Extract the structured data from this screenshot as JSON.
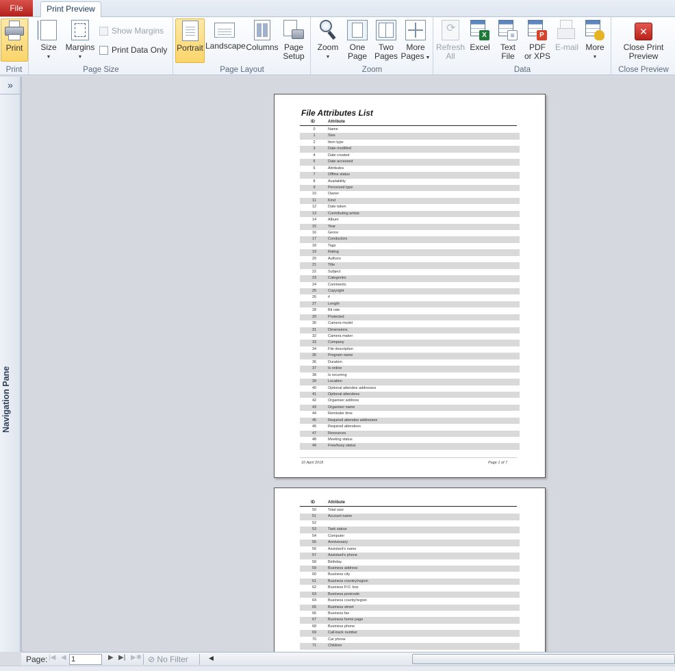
{
  "tabs": {
    "file": "File",
    "print_preview": "Print Preview"
  },
  "ribbon": {
    "print_group": {
      "label": "Print",
      "print_button": "Print"
    },
    "page_size_group": {
      "label": "Page Size",
      "size": "Size",
      "margins": "Margins",
      "show_margins": "Show Margins",
      "print_data_only": "Print Data Only"
    },
    "page_layout_group": {
      "label": "Page Layout",
      "portrait": "Portrait",
      "landscape": "Landscape",
      "columns": "Columns",
      "page_setup_1": "Page",
      "page_setup_2": "Setup"
    },
    "zoom_group": {
      "label": "Zoom",
      "zoom": "Zoom",
      "one_page_1": "One",
      "one_page_2": "Page",
      "two_pages_1": "Two",
      "two_pages_2": "Pages",
      "more_pages_1": "More",
      "more_pages_2": "Pages"
    },
    "data_group": {
      "label": "Data",
      "refresh_1": "Refresh",
      "refresh_2": "All",
      "excel": "Excel",
      "text_file_1": "Text",
      "text_file_2": "File",
      "pdf_1": "PDF",
      "pdf_2": "or XPS",
      "email": "E-mail",
      "more": "More"
    },
    "close_group": {
      "label": "Close Preview",
      "close_1": "Close Print",
      "close_2": "Preview"
    }
  },
  "nav_pane": {
    "label": "Navigation Pane",
    "expand": "»"
  },
  "report": {
    "title": "File Attributes List",
    "col_id": "ID",
    "col_attribute": "Attribute",
    "footer_date": "10 April 2018",
    "footer_page": "Page 1 of 7",
    "page1_rows": [
      [
        "0",
        "Name"
      ],
      [
        "1",
        "Size"
      ],
      [
        "2",
        "Item type"
      ],
      [
        "3",
        "Date modified"
      ],
      [
        "4",
        "Date created"
      ],
      [
        "5",
        "Date accessed"
      ],
      [
        "6",
        "Attributes"
      ],
      [
        "7",
        "Offline status"
      ],
      [
        "8",
        "Availability"
      ],
      [
        "9",
        "Perceived type"
      ],
      [
        "10",
        "Owner"
      ],
      [
        "11",
        "Kind"
      ],
      [
        "12",
        "Date taken"
      ],
      [
        "13",
        "Contributing artists"
      ],
      [
        "14",
        "Album"
      ],
      [
        "15",
        "Year"
      ],
      [
        "16",
        "Genre"
      ],
      [
        "17",
        "Conductors"
      ],
      [
        "18",
        "Tags"
      ],
      [
        "19",
        "Rating"
      ],
      [
        "20",
        "Authors"
      ],
      [
        "21",
        "Title"
      ],
      [
        "22",
        "Subject"
      ],
      [
        "23",
        "Categories"
      ],
      [
        "24",
        "Comments"
      ],
      [
        "25",
        "Copyright"
      ],
      [
        "26",
        "#"
      ],
      [
        "27",
        "Length"
      ],
      [
        "28",
        "Bit rate"
      ],
      [
        "29",
        "Protected"
      ],
      [
        "30",
        "Camera model"
      ],
      [
        "31",
        "Dimensions"
      ],
      [
        "32",
        "Camera maker"
      ],
      [
        "33",
        "Company"
      ],
      [
        "34",
        "File description"
      ],
      [
        "35",
        "Program name"
      ],
      [
        "36",
        "Duration"
      ],
      [
        "37",
        "Is online"
      ],
      [
        "38",
        "Is recurring"
      ],
      [
        "39",
        "Location"
      ],
      [
        "40",
        "Optional attendee addresses"
      ],
      [
        "41",
        "Optional attendees"
      ],
      [
        "42",
        "Organiser address"
      ],
      [
        "43",
        "Organiser name"
      ],
      [
        "44",
        "Reminder time"
      ],
      [
        "45",
        "Required attendee addresses"
      ],
      [
        "46",
        "Required attendees"
      ],
      [
        "47",
        "Resources"
      ],
      [
        "48",
        "Meeting status"
      ],
      [
        "49",
        "Free/busy status"
      ]
    ],
    "page2_rows": [
      [
        "50",
        "Total size"
      ],
      [
        "51",
        "Account name"
      ],
      [
        "52",
        ""
      ],
      [
        "53",
        "Task status"
      ],
      [
        "54",
        "Computer"
      ],
      [
        "55",
        "Anniversary"
      ],
      [
        "56",
        "Assistant's name"
      ],
      [
        "57",
        "Assistant's phone"
      ],
      [
        "58",
        "Birthday"
      ],
      [
        "59",
        "Business address"
      ],
      [
        "60",
        "Business city"
      ],
      [
        "61",
        "Business country/region"
      ],
      [
        "62",
        "Business P.O. box"
      ],
      [
        "63",
        "Business postcode"
      ],
      [
        "64",
        "Business county/region"
      ],
      [
        "65",
        "Business street"
      ],
      [
        "66",
        "Business fax"
      ],
      [
        "67",
        "Business home page"
      ],
      [
        "68",
        "Business phone"
      ],
      [
        "69",
        "Call-back number"
      ],
      [
        "70",
        "Car phone"
      ],
      [
        "71",
        "Children"
      ]
    ]
  },
  "statusbar": {
    "page_label": "Page:",
    "page_value": "1",
    "filter": "No Filter"
  }
}
